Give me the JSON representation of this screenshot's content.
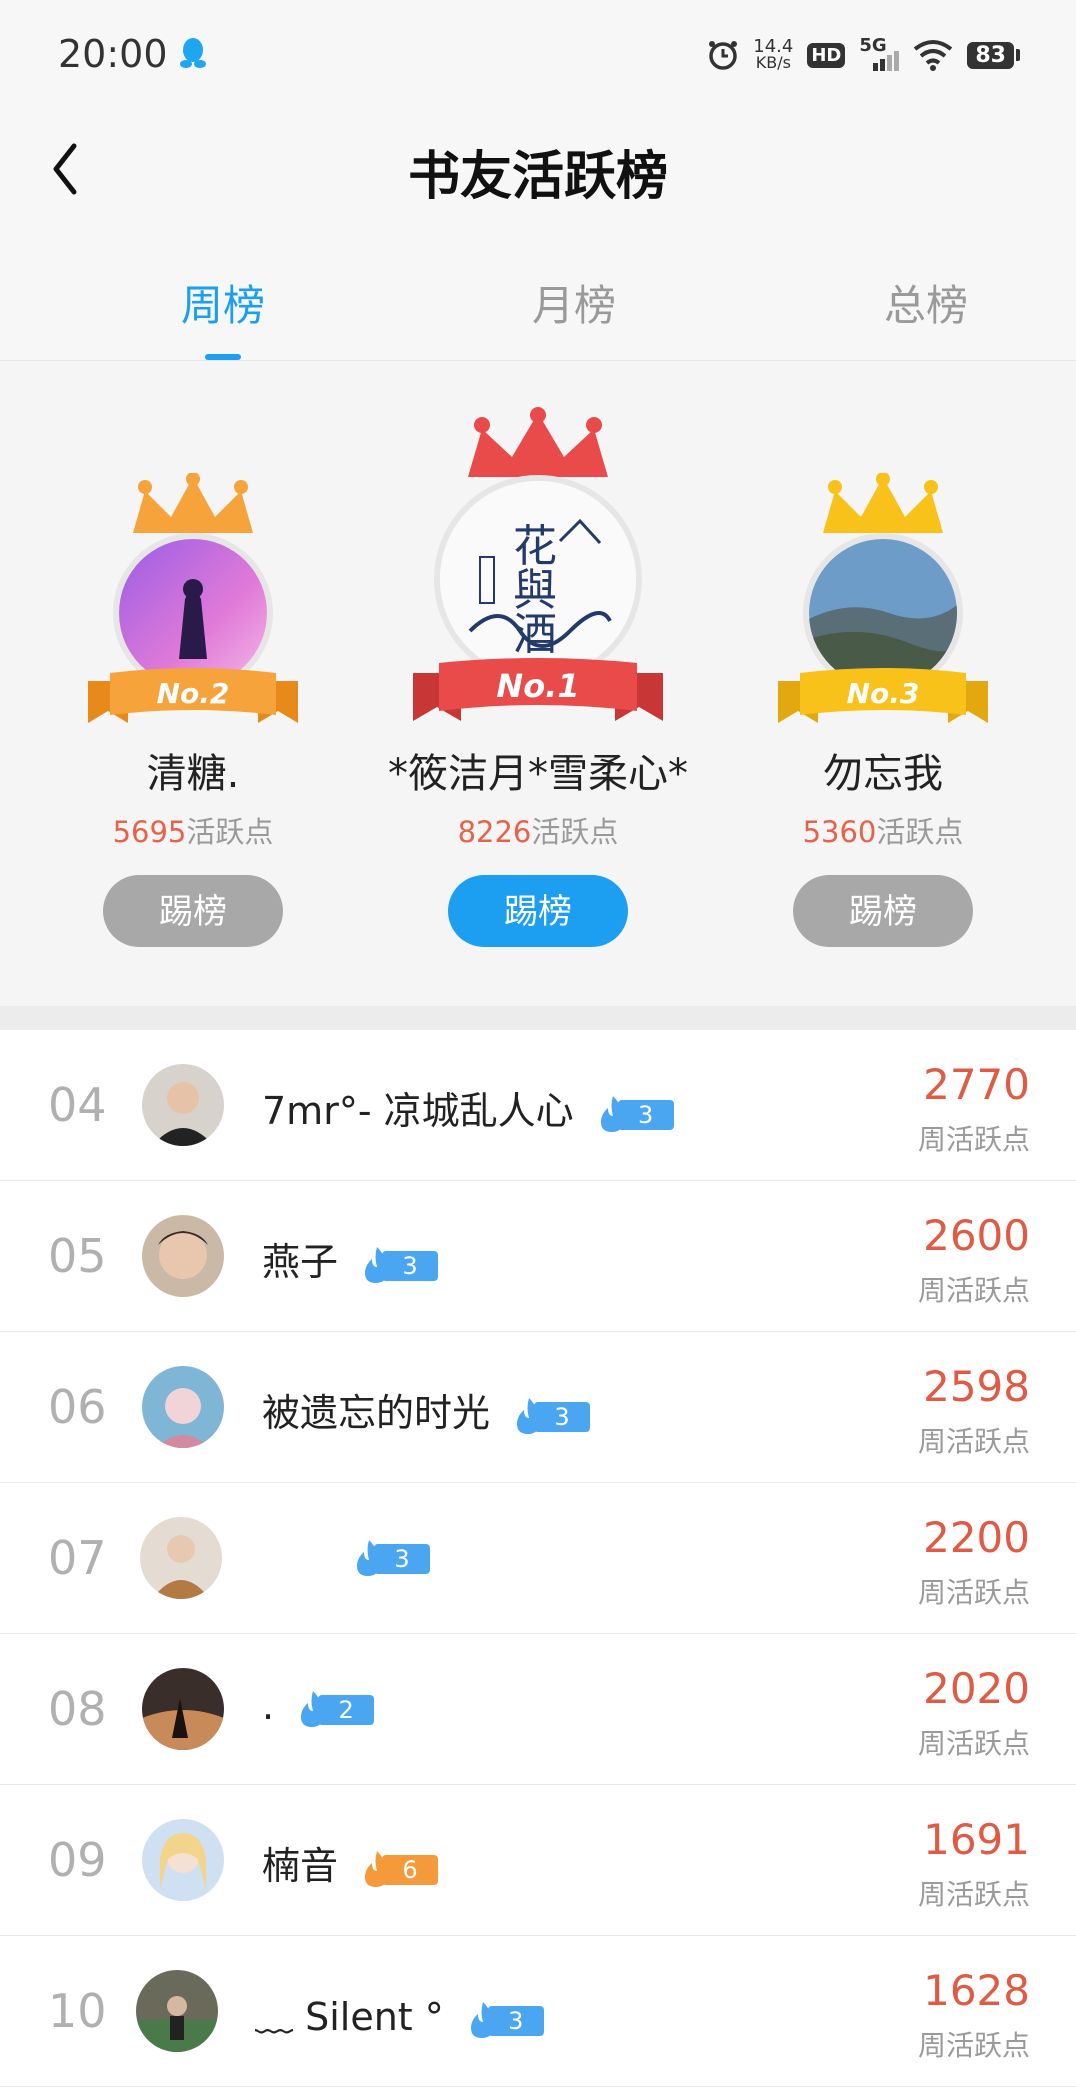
{
  "status_bar": {
    "time": "20:00",
    "net_speed": "14.4",
    "net_unit": "KB/s",
    "hd": "HD",
    "signal": "5G",
    "battery": "83"
  },
  "header": {
    "title": "书友活跃榜"
  },
  "tabs": [
    {
      "label": "周榜",
      "active": true
    },
    {
      "label": "月榜",
      "active": false
    },
    {
      "label": "总榜",
      "active": false
    }
  ],
  "podium": {
    "points_suffix": "活跃点",
    "kick_label": "踢榜",
    "first": {
      "badge": "No.1",
      "name": "*筱洁月*雪柔心*",
      "points": "8226"
    },
    "second": {
      "badge": "No.2",
      "name": "清糖.",
      "points": "5695"
    },
    "third": {
      "badge": "No.3",
      "name": "勿忘我",
      "points": "5360"
    }
  },
  "list": {
    "score_label": "周活跃点",
    "rows": [
      {
        "rank": "04",
        "name": "7mr°-  凉城乱人心",
        "level": "3",
        "score": "2770"
      },
      {
        "rank": "05",
        "name": "燕子",
        "level": "3",
        "score": "2600"
      },
      {
        "rank": "06",
        "name": "被遗忘的时光",
        "level": "3",
        "score": "2598"
      },
      {
        "rank": "07",
        "name": "",
        "level": "3",
        "score": "2200"
      },
      {
        "rank": "08",
        "name": ".",
        "level": "2",
        "score": "2020"
      },
      {
        "rank": "09",
        "name": "楠音",
        "level": "6",
        "score": "1691"
      },
      {
        "rank": "10",
        "name": "﹏ Silent °",
        "level": "3",
        "score": "1628"
      }
    ]
  },
  "colors": {
    "accent": "#1c9ff0",
    "score": "#e05a44",
    "gold": "#f5a623",
    "red": "#e94a4a",
    "orange": "#f28b22"
  }
}
